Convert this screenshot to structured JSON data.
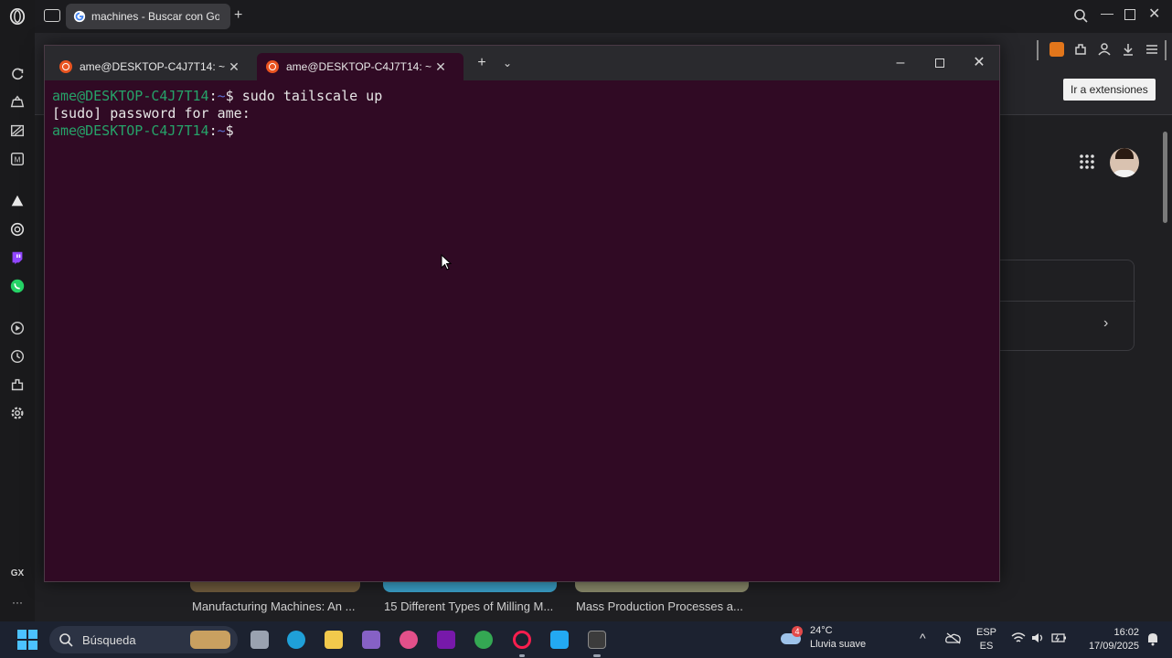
{
  "browser": {
    "tab_title": "machines - Buscar con Google",
    "extensions_tooltip": "Ir a extensiones",
    "opera_gx_label": "GX",
    "more_label": "···",
    "result_captions": [
      "Manufacturing Machines: An ...",
      "15 Different Types of Milling M...",
      "Mass Production Processes a..."
    ]
  },
  "terminal": {
    "tabs": [
      {
        "label": "ame@DESKTOP-C4J7T14: ~"
      },
      {
        "label": "ame@DESKTOP-C4J7T14: ~"
      }
    ],
    "lines": [
      {
        "user": "ame@DESKTOP-C4J7T14",
        "sep": ":",
        "path": "~",
        "symbol": "$ ",
        "text": "sudo tailscale up"
      },
      {
        "plain": "[sudo] password for ame:"
      },
      {
        "user": "ame@DESKTOP-C4J7T14",
        "sep": ":",
        "path": "~",
        "symbol": "$ ",
        "text": ""
      }
    ]
  },
  "taskbar": {
    "search_label": "Búsqueda",
    "weather_badge": "4",
    "weather_temp": "24°C",
    "weather_desc": "Lluvia suave",
    "lang_top": "ESP",
    "lang_bottom": "ES",
    "time": "16:02",
    "date": "17/09/2025"
  },
  "colors": {
    "terminal_bg": "#300a24",
    "prompt_user": "#26a269",
    "prompt_path": "#5c6ed0",
    "ubuntu_orange": "#e95420"
  }
}
